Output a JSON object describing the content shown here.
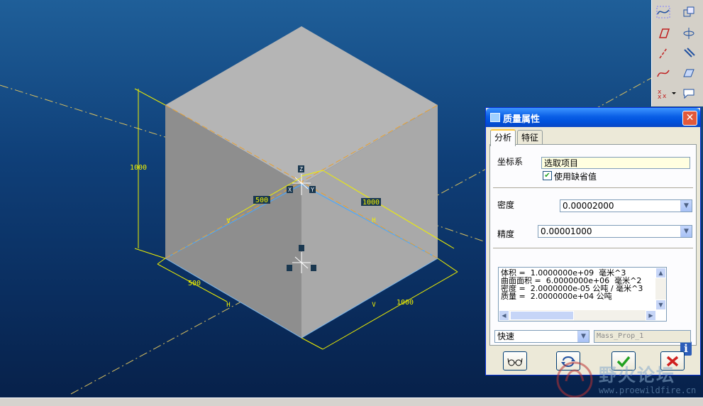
{
  "viewport": {
    "dimensions": {
      "cube_height": "1000",
      "depth_left": "500",
      "depth_right": "1000",
      "bottom_left": "500",
      "bottom_right": "1000"
    },
    "axis_labels": {
      "x": "X",
      "y": "Y",
      "z": "Z",
      "h_mid": "H",
      "v_mid": "V",
      "h_bottom": "H",
      "v_bottom": "V"
    },
    "colors": {
      "cube_top": "#b9b9b9",
      "cube_left": "#8c8c8c",
      "cube_right": "#a8a8a8",
      "dimension": "#f0f000",
      "centerline": "#e8a030",
      "edge_highlight": "#47a8ff"
    }
  },
  "toolbar": {
    "icons": [
      "sketch-curve-icon",
      "copy-feature-icon",
      "plane-icon",
      "axis-icon",
      "axis-line-icon",
      "pattern-icon",
      "curve-icon",
      "surface-icon",
      "point-icon",
      "more-icon",
      "dropdown-icon",
      "comment-icon"
    ]
  },
  "dialog": {
    "title": "质量属性",
    "close_label": "✕",
    "tabs": [
      {
        "label": "分析"
      },
      {
        "label": "特征"
      }
    ],
    "coord_system_label": "坐标系",
    "selection_placeholder": "选取项目",
    "use_default_label": "使用缺省值",
    "use_default_checked": true,
    "density_label": "密度",
    "density_value": "0.00002000",
    "accuracy_label": "精度",
    "accuracy_value": "0.00001000",
    "results": [
      "体积 =  1.0000000e+09  毫米^3",
      "曲面面积 =  6.0000000e+06  毫米^2",
      "密度 =  2.0000000e-05 公吨 / 毫米^3",
      "质量 =  2.0000000e+04 公吨"
    ],
    "mode_value": "快速",
    "name_field_value": "Mass_Prop_1",
    "buttons": [
      "preview",
      "repeat",
      "ok",
      "cancel"
    ]
  },
  "watermark": {
    "title": "野火论坛",
    "url": "www.proewildfire.cn"
  }
}
